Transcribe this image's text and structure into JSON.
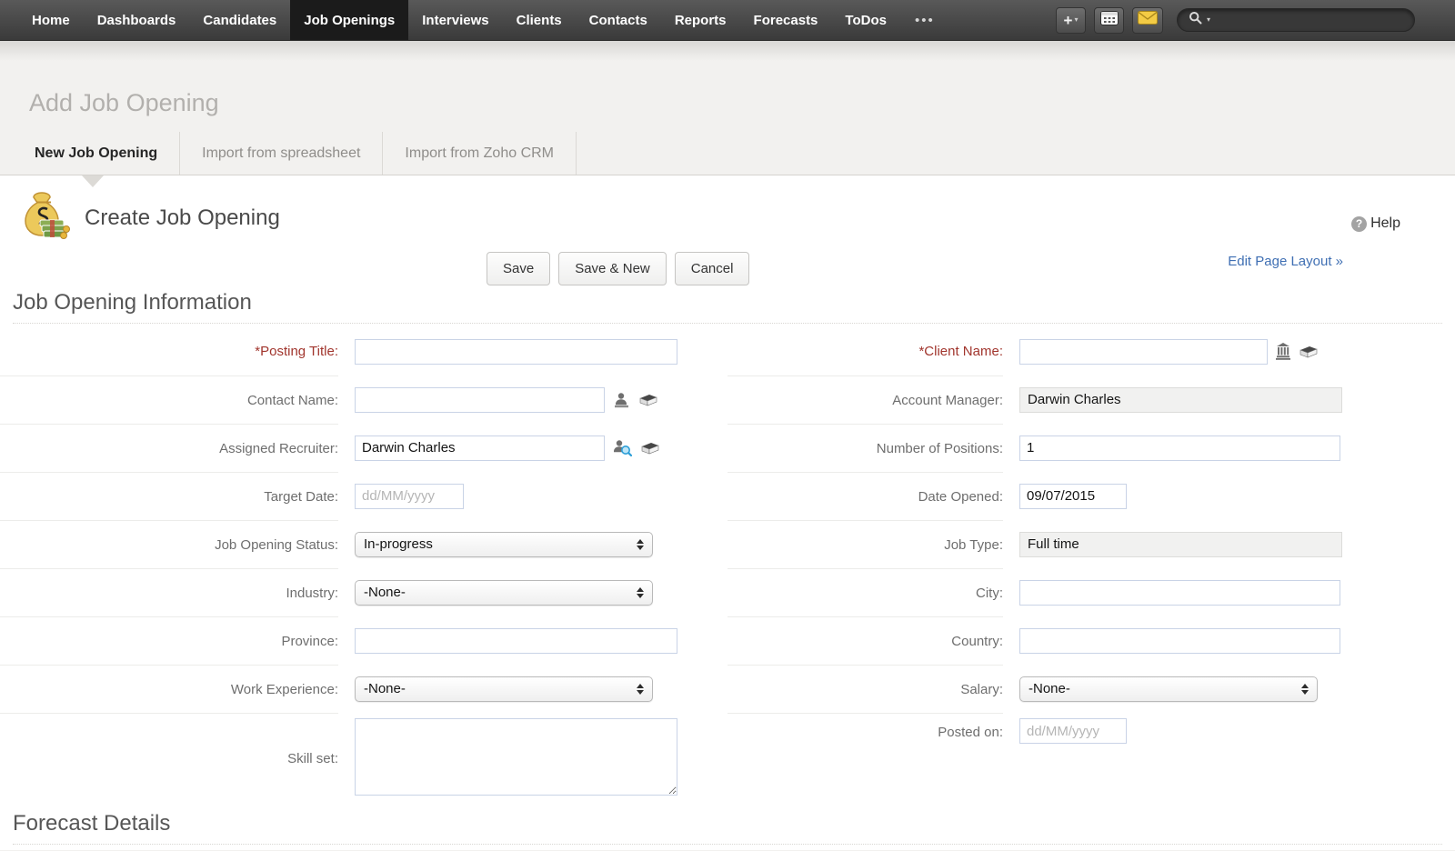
{
  "nav": {
    "items": [
      "Home",
      "Dashboards",
      "Candidates",
      "Job Openings",
      "Interviews",
      "Clients",
      "Contacts",
      "Reports",
      "Forecasts",
      "ToDos"
    ],
    "active_item": "Job Openings",
    "overflow_label": "•••",
    "add_label": "+",
    "caret_glyph": "▾"
  },
  "page": {
    "title": "Add Job Opening"
  },
  "tabs": [
    {
      "label": "New Job Opening",
      "active": true
    },
    {
      "label": "Import from spreadsheet",
      "active": false
    },
    {
      "label": "Import from Zoho CRM",
      "active": false
    }
  ],
  "record_header": {
    "title": "Create Job Opening",
    "help_label": "Help",
    "help_glyph": "?"
  },
  "links": {
    "edit_page_layout": "Edit Page Layout »"
  },
  "buttons": {
    "save": "Save",
    "save_and_new": "Save & New",
    "cancel": "Cancel"
  },
  "sections": {
    "job_opening_information": "Job Opening Information",
    "forecast_details": "Forecast Details"
  },
  "fields": {
    "posting_title": {
      "label": "*Posting Title:",
      "value": ""
    },
    "client_name": {
      "label": "*Client Name:",
      "value": ""
    },
    "contact_name": {
      "label": "Contact Name:",
      "value": ""
    },
    "account_manager": {
      "label": "Account Manager:",
      "value": "Darwin Charles"
    },
    "assigned_recruiter": {
      "label": "Assigned Recruiter:",
      "value": "Darwin Charles"
    },
    "number_of_positions": {
      "label": "Number of Positions:",
      "value": "1"
    },
    "target_date": {
      "label": "Target Date:",
      "value": "",
      "placeholder": "dd/MM/yyyy"
    },
    "date_opened": {
      "label": "Date Opened:",
      "value": "09/07/2015"
    },
    "job_opening_status": {
      "label": "Job Opening Status:",
      "value": "In-progress"
    },
    "job_type": {
      "label": "Job Type:",
      "value": "Full time"
    },
    "industry": {
      "label": "Industry:",
      "value": "-None-"
    },
    "city": {
      "label": "City:",
      "value": ""
    },
    "province": {
      "label": "Province:",
      "value": ""
    },
    "country": {
      "label": "Country:",
      "value": ""
    },
    "work_experience": {
      "label": "Work Experience:",
      "value": "-None-"
    },
    "salary": {
      "label": "Salary:",
      "value": "-None-"
    },
    "skill_set": {
      "label": "Skill set:",
      "value": ""
    },
    "posted_on": {
      "label": "Posted on:",
      "value": "",
      "placeholder": "dd/MM/yyyy"
    }
  },
  "colors": {
    "required_label": "#a1352d",
    "link_blue": "#3f6fb3",
    "nav_active_bg": "#1b1b1b",
    "envelope_yellow": "#f3cb45"
  }
}
